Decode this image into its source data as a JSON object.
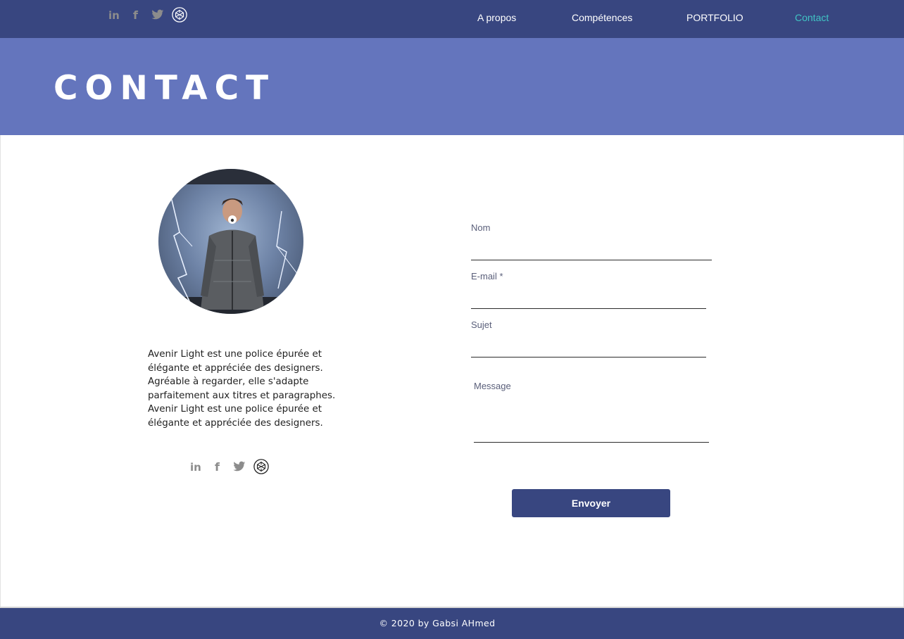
{
  "social_links": [
    {
      "icon": "linkedin-icon",
      "glyph": "in"
    },
    {
      "icon": "facebook-icon",
      "glyph": "f"
    },
    {
      "icon": "twitter-icon",
      "glyph": "t"
    },
    {
      "icon": "codepen-icon",
      "glyph": "cp"
    }
  ],
  "nav": {
    "items": [
      {
        "label": "A propos",
        "active": false
      },
      {
        "label": "Compétences",
        "active": false
      },
      {
        "label": "PORTFOLIO",
        "active": false
      },
      {
        "label": "Contact",
        "active": true
      }
    ]
  },
  "header": {
    "title": "CONTACT"
  },
  "bio": {
    "text": "Avenir Light est une police épurée et élégante et appréciée des designers. Agréable à regarder, elle s'adapte parfaitement aux titres et paragraphes. Avenir Light est une police épurée et élégante et appréciée des designers."
  },
  "form": {
    "name_label": "Nom",
    "name_value": "",
    "email_label": "E-mail *",
    "email_value": "",
    "subject_label": "Sujet",
    "subject_value": "",
    "message_label": "Message",
    "message_value": "",
    "submit_label": "Envoyer"
  },
  "footer": {
    "text": "© 2020 by Gabsi AHmed"
  },
  "colors": {
    "navbar": "#384680",
    "header_band": "#6475bd",
    "active_link": "#40c4c4",
    "button": "#384680",
    "social_icon_gray": "#8c8c8c"
  }
}
